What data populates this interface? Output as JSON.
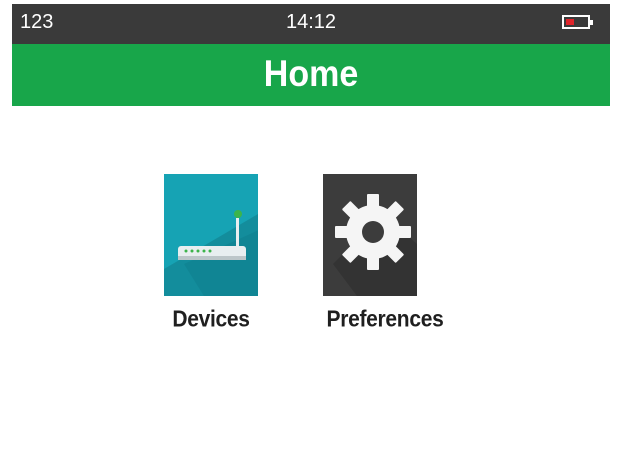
{
  "status_bar": {
    "left_text": "123",
    "time": "14:12",
    "battery_icon": "battery-low-icon",
    "battery_color": "#e0242a"
  },
  "header": {
    "title": "Home",
    "color": "#18a64a"
  },
  "tiles": [
    {
      "label": "Devices",
      "icon": "router-icon",
      "color": "#16a3b4"
    },
    {
      "label": "Preferences",
      "icon": "gear-icon",
      "color": "#3c3c3c"
    }
  ]
}
